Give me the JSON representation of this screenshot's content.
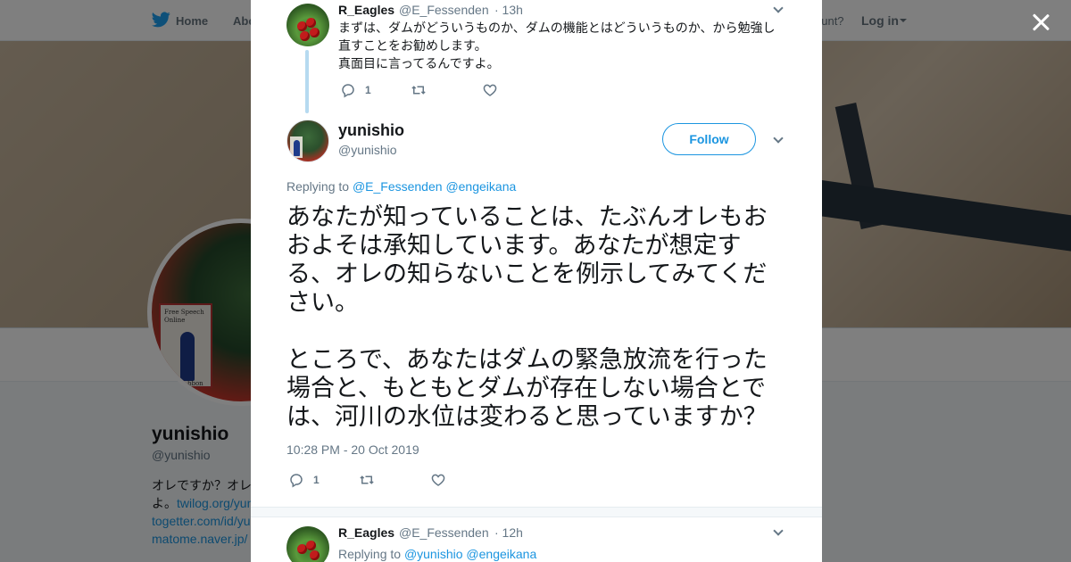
{
  "topbar": {
    "home_label": "Home",
    "about_label": "Abo",
    "have_account_text": "ccount?",
    "login_label": "Log in"
  },
  "profile": {
    "name": "yunishio",
    "handle": "@yunishio",
    "sign_text": "Free Speech\nOnline",
    "sign_bottom": "bbon",
    "bio_line1": "オレですか？オレ",
    "bio_line2_prefix": "よ。",
    "bio_link1": "twilog.org/yun",
    "bio_link2": "togetter.com/id/yu",
    "bio_link3": "matome.naver.jp/"
  },
  "parent_tweet": {
    "name": "R_Eagles",
    "handle": "@E_Fessenden",
    "time": "· 13h",
    "line1": "まずは、ダムがどういうものか、ダムの機能とはどういうものか、から勉強し",
    "line2": "直すことをお勧めします。",
    "line3": "真面目に言ってるんですよ。",
    "reply_count": "1"
  },
  "main_tweet": {
    "name": "yunishio",
    "handle": "@yunishio",
    "follow_label": "Follow",
    "replying_prefix": "Replying to",
    "mention1": "@E_Fessenden",
    "mention2": "@engeikana",
    "para1": "あなたが知っていることは、たぶんオレもおおよそは承知しています。あなたが想定する、オレの知らないことを例示してみてください。",
    "para2": "ところで、あなたはダムの緊急放流を行った場合と、もともとダムが存在しない場合とでは、河川の水位は変わると思っていますか？",
    "timestamp": "10:28 PM - 20 Oct 2019",
    "reply_count": "1"
  },
  "reply_tweet": {
    "name": "R_Eagles",
    "handle": "@E_Fessenden",
    "time": "· 12h",
    "replying_prefix": "Replying to",
    "mention1": "@yunishio",
    "mention2": "@engeikana"
  },
  "icons": {
    "close": "close-icon",
    "bird": "twitter-bird-icon",
    "reply": "reply-icon",
    "retweet": "retweet-icon",
    "like": "heart-icon"
  },
  "colors": {
    "accent": "#1b95e0",
    "muted": "#657786",
    "text": "#14171a",
    "thread_line": "#b6daf0"
  }
}
